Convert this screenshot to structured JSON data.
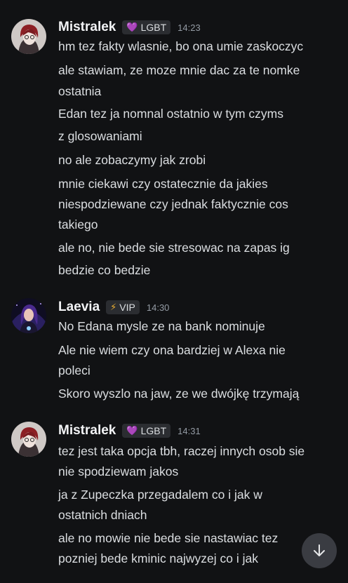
{
  "messages": [
    {
      "author": "Mistralek",
      "tag": {
        "icon": "purple-heart-icon",
        "label": "LGBT"
      },
      "time": "14:23",
      "lines": [
        "hm tez fakty wlasnie, bo ona umie zaskoczyc",
        "ale stawiam, ze moze mnie dac za te nomke",
        "ostatnia",
        "Edan tez ja nomnal ostatnio w tym czyms",
        "z glosowaniami",
        "no ale zobaczymy jak zrobi",
        "mnie ciekawi czy ostatecznie da jakies",
        "niespodziewane czy jednak faktycznie cos",
        "takiego",
        "ale no, nie bede sie stresowac na zapas ig",
        "bedzie co bedzie"
      ]
    },
    {
      "author": "Laevia",
      "tag": {
        "icon": "lightning-icon",
        "label": "VIP"
      },
      "time": "14:30",
      "lines": [
        "No Edana mysle ze na bank nominuje",
        "Ale nie wiem czy ona bardziej w Alexa nie",
        "poleci",
        "Skoro wyszlo na jaw, ze we dwójkę trzymają"
      ]
    },
    {
      "author": "Mistralek",
      "tag": {
        "icon": "purple-heart-icon",
        "label": "LGBT"
      },
      "time": "14:31",
      "lines": [
        "tez jest taka opcja tbh, raczej innych osob sie",
        "nie spodziewam jakos",
        "ja z Zupeczka przegadalem co i jak w",
        "ostatnich dniach",
        "ale no mowie nie bede sie nastawiac tez",
        "pozniej bede kminic najwyzej co i jak"
      ]
    }
  ],
  "colors": {
    "background": "#111214",
    "text": "#dbdee1",
    "timestamp": "#949ba4",
    "heart": "#c67be8",
    "lightning": "#f0b232"
  }
}
